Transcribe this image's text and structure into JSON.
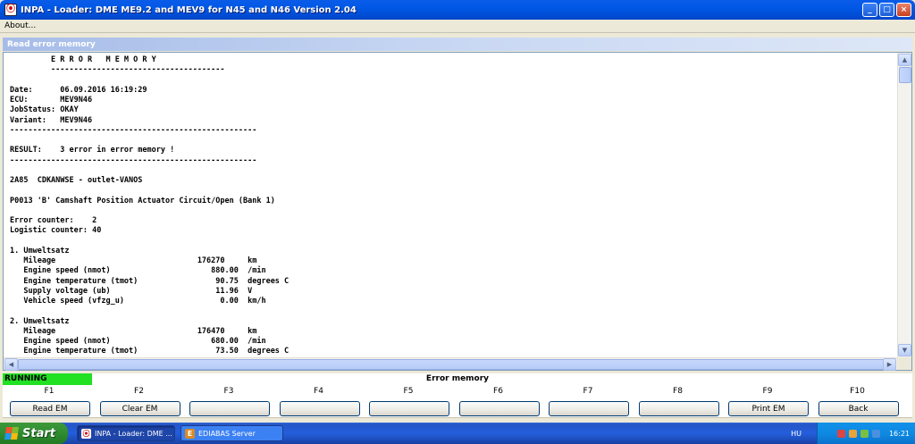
{
  "window": {
    "title": "INPA - Loader:  DME ME9.2 and MEV9 for N45 and N46 Version 2.04",
    "minimize": "_",
    "maximize": "□",
    "close": "×"
  },
  "menu": {
    "about": "About..."
  },
  "panel": {
    "title": "Read error memory"
  },
  "text_lines": [
    "         E R R O R   M E M O R Y",
    "         --------------------------------------",
    "",
    "Date:      06.09.2016 16:19:29",
    "ECU:       MEV9N46",
    "JobStatus: OKAY",
    "Variant:   MEV9N46",
    "------------------------------------------------------",
    "",
    "RESULT:    3 error in error memory !",
    "------------------------------------------------------",
    "",
    "2A85  CDKANWSE - outlet-VANOS",
    "",
    "P0013 'B' Camshaft Position Actuator Circuit/Open (Bank 1)",
    "",
    "Error counter:    2",
    "Logistic counter: 40",
    "",
    "1. Umweltsatz",
    "   Mileage                               176270     km",
    "   Engine speed (nmot)                      880.00  /min",
    "   Engine temperature (tmot)                 90.75  degrees C",
    "   Supply voltage (ub)                       11.96  V",
    "   Vehicle speed (vfzg_u)                     0.00  km/h",
    "",
    "2. Umweltsatz",
    "   Mileage                               176470     km",
    "   Engine speed (nmot)                      680.00  /min",
    "   Engine temperature (tmot)                 73.50  degrees C"
  ],
  "status": {
    "state": "RUNNING",
    "center": "Error memory"
  },
  "fkeys": [
    {
      "key": "F1",
      "label": "Read EM"
    },
    {
      "key": "F2",
      "label": "Clear EM"
    },
    {
      "key": "F3",
      "label": ""
    },
    {
      "key": "F4",
      "label": ""
    },
    {
      "key": "F5",
      "label": ""
    },
    {
      "key": "F6",
      "label": ""
    },
    {
      "key": "F7",
      "label": ""
    },
    {
      "key": "F8",
      "label": ""
    },
    {
      "key": "F9",
      "label": "Print EM"
    },
    {
      "key": "F10",
      "label": "Back"
    }
  ],
  "taskbar": {
    "start": "Start",
    "tasks": [
      {
        "label": "INPA - Loader:  DME ...",
        "active": true
      },
      {
        "label": "EDIABAS Server",
        "active": false
      }
    ],
    "language": "HU",
    "clock": "16:21"
  },
  "colors": {
    "running_bg": "#22e022",
    "title_bar": "#0058e6",
    "taskbar": "#245edc"
  }
}
